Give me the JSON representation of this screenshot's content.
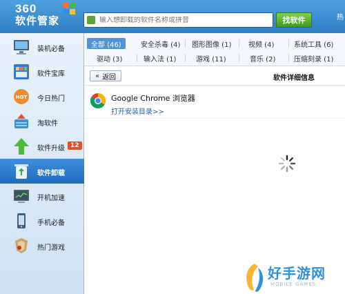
{
  "header": {
    "logo_number": "360",
    "logo_name": "软件管家",
    "search_placeholder": "输入想卸载的软件名称或拼音",
    "search_button": "找软件",
    "right_text": "热"
  },
  "sidebar": {
    "items": [
      {
        "label": "装机必备",
        "icon": "monitor-icon"
      },
      {
        "label": "软件宝库",
        "icon": "app-grid-icon"
      },
      {
        "label": "今日热门",
        "icon": "hot-icon"
      },
      {
        "label": "淘软件",
        "icon": "basket-icon"
      },
      {
        "label": "软件升级",
        "icon": "upgrade-arrow-icon",
        "badge": "12"
      },
      {
        "label": "软件卸载",
        "icon": "recycle-bin-icon"
      },
      {
        "label": "开机加速",
        "icon": "boot-speed-icon"
      },
      {
        "label": "手机必备",
        "icon": "phone-icon"
      },
      {
        "label": "热门游戏",
        "icon": "game-icon"
      }
    ]
  },
  "filters": {
    "tabs": [
      {
        "label": "全部 (46)"
      },
      {
        "label": "安全杀毒 (4)"
      },
      {
        "label": "图形图像 (1)"
      },
      {
        "label": "视频 (4)"
      },
      {
        "label": "系统工具 (6)"
      },
      {
        "label": "驱动 (3)"
      },
      {
        "label": "输入法 (1)"
      },
      {
        "label": "游戏 (11)"
      },
      {
        "label": "音乐 (2)"
      },
      {
        "label": "压缩刻录 (1)"
      }
    ]
  },
  "detail": {
    "back_label": "返回",
    "title": "软件详细信息",
    "app_name": "Google Chrome 浏览器",
    "open_dir_link": "打开安装目录>>"
  },
  "watermark": {
    "text": "好手游网",
    "sub": "MOBILE GAMES"
  },
  "colors": {
    "header_blue": "#2f7fc4",
    "active_item": "#1f6cc0",
    "search_green": "#3f9a1e",
    "badge": "#e0502a"
  }
}
